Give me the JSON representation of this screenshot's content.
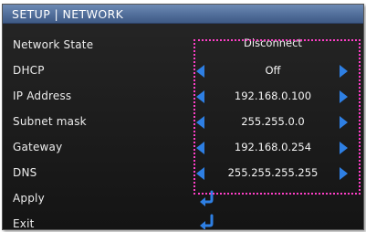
{
  "menu": {
    "title": "SETUP | NETWORK",
    "rows": [
      {
        "label": "Network State",
        "value": "Disconnect"
      },
      {
        "label": "DHCP",
        "value": "Off"
      },
      {
        "label": "IP Address",
        "value": "192.168.0.100"
      },
      {
        "label": "Subnet mask",
        "value": "255.255.0.0"
      },
      {
        "label": "Gateway",
        "value": "192.168.0.254"
      },
      {
        "label": "DNS",
        "value": "255.255.255.255"
      },
      {
        "label": "Apply"
      },
      {
        "label": "Exit"
      }
    ]
  },
  "colors": {
    "title_bar": "#5575a3",
    "background": "#1c1c1c",
    "arrow": "#2e7fe3",
    "highlight_border": "#ff3fc8",
    "text": "#ececec"
  },
  "icons": {
    "left_arrow": "arrow-left-icon",
    "right_arrow": "arrow-right-icon",
    "enter": "enter-return-icon"
  }
}
